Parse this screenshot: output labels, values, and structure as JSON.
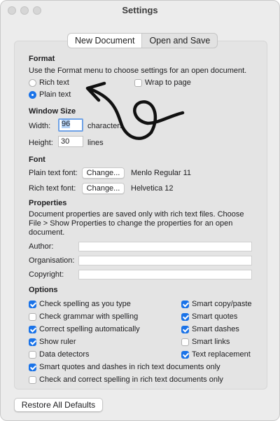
{
  "window": {
    "title": "Settings"
  },
  "tabs": [
    {
      "label": "New Document",
      "active": true
    },
    {
      "label": "Open and Save",
      "active": false
    }
  ],
  "format": {
    "heading": "Format",
    "description": "Use the Format menu to choose settings for an open document.",
    "rich_text_label": "Rich text",
    "plain_text_label": "Plain text",
    "wrap_label": "Wrap to page",
    "selected": "plain_text",
    "wrap_checked": false
  },
  "window_size": {
    "heading": "Window Size",
    "width_label": "Width:",
    "width_value": "96",
    "width_unit": "characters",
    "height_label": "Height:",
    "height_value": "30",
    "height_unit": "lines"
  },
  "font": {
    "heading": "Font",
    "plain_label": "Plain text font:",
    "plain_button": "Change...",
    "plain_value": "Menlo Regular 11",
    "rich_label": "Rich text font:",
    "rich_button": "Change...",
    "rich_value": "Helvetica 12"
  },
  "properties": {
    "heading": "Properties",
    "description_1": "Document properties are saved only with rich text files. Choose",
    "description_2": "File > Show Properties to change the properties for an open",
    "description_3": "document.",
    "author_label": "Author:",
    "author_value": "",
    "organisation_label": "Organisation:",
    "organisation_value": "",
    "copyright_label": "Copyright:",
    "copyright_value": ""
  },
  "options": {
    "heading": "Options",
    "left": [
      {
        "label": "Check spelling as you type",
        "checked": true
      },
      {
        "label": "Check grammar with spelling",
        "checked": false
      },
      {
        "label": "Correct spelling automatically",
        "checked": true
      },
      {
        "label": "Show ruler",
        "checked": true
      },
      {
        "label": "Data detectors",
        "checked": false
      }
    ],
    "right": [
      {
        "label": "Smart copy/paste",
        "checked": true
      },
      {
        "label": "Smart quotes",
        "checked": true
      },
      {
        "label": "Smart dashes",
        "checked": true
      },
      {
        "label": "Smart links",
        "checked": false
      },
      {
        "label": "Text replacement",
        "checked": true
      }
    ],
    "full": [
      {
        "label": "Smart quotes and dashes in rich text documents only",
        "checked": true
      },
      {
        "label": "Check and correct spelling in rich text documents only",
        "checked": false
      }
    ]
  },
  "footer": {
    "restore_label": "Restore All Defaults"
  },
  "colors": {
    "accent": "#1a73e8",
    "panel": "#e4e4e4",
    "window": "#ececec",
    "annotation": "#111111"
  }
}
